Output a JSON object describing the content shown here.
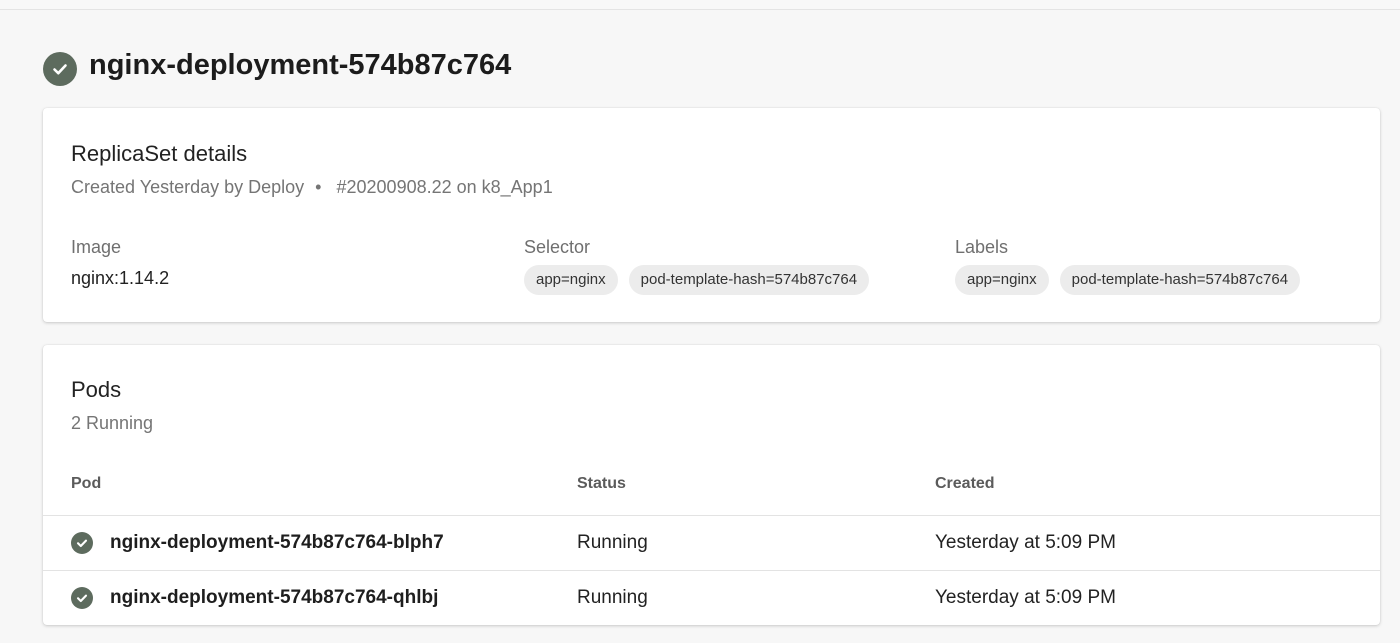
{
  "page": {
    "title": "nginx-deployment-574b87c764",
    "status_icon": "check-circle-icon",
    "status_color": "#5d6b5e"
  },
  "details": {
    "title": "ReplicaSet details",
    "subtitle_created": "Created Yesterday by Deploy",
    "subtitle_separator": "•",
    "subtitle_run": "#20200908.22 on k8_App1",
    "image_label": "Image",
    "image_value": "nginx:1.14.2",
    "selector_label": "Selector",
    "selector_chips": [
      "app=nginx",
      "pod-template-hash=574b87c764"
    ],
    "labels_label": "Labels",
    "labels_chips": [
      "app=nginx",
      "pod-template-hash=574b87c764"
    ]
  },
  "pods": {
    "title": "Pods",
    "subtitle": "2 Running",
    "columns": [
      "Pod",
      "Status",
      "Created"
    ],
    "rows": [
      {
        "name": "nginx-deployment-574b87c764-blph7",
        "status": "Running",
        "created": "Yesterday at 5:09 PM"
      },
      {
        "name": "nginx-deployment-574b87c764-qhlbj",
        "status": "Running",
        "created": "Yesterday at 5:09 PM"
      }
    ]
  }
}
